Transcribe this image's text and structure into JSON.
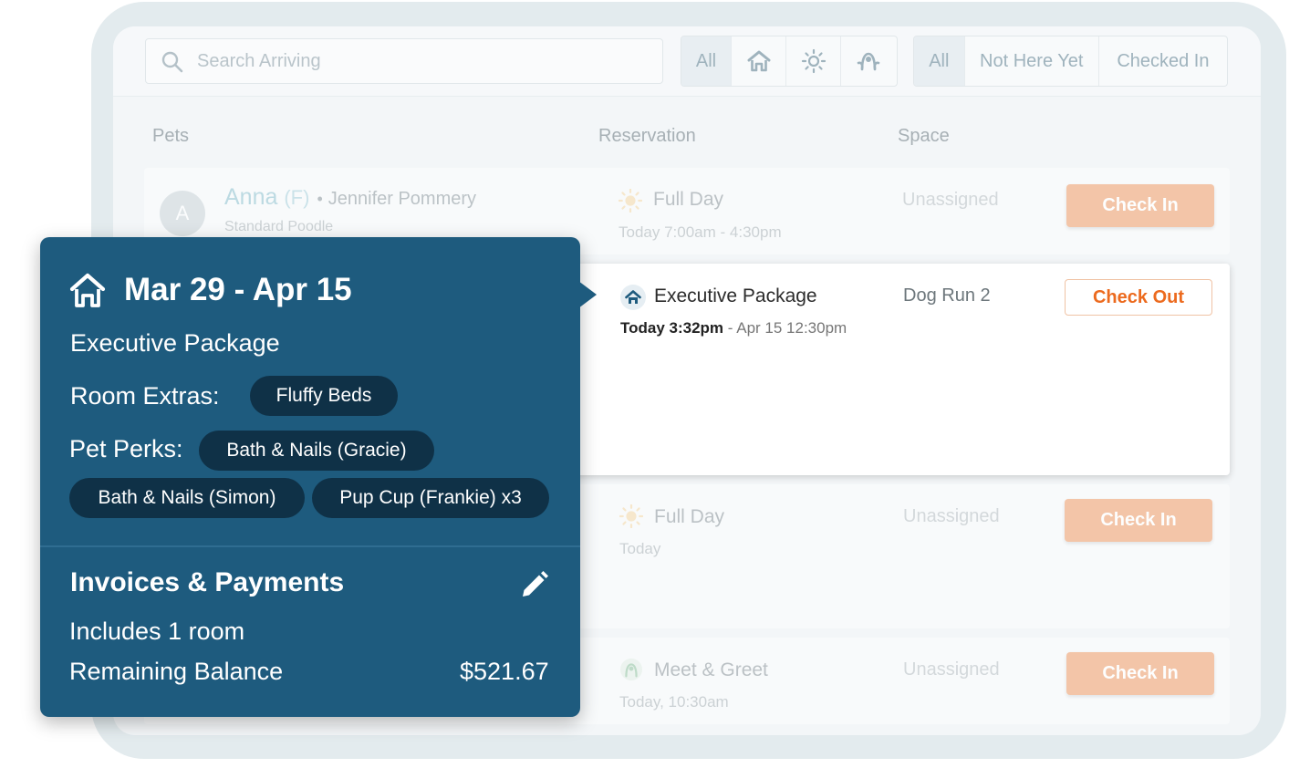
{
  "search": {
    "placeholder": "Search Arriving"
  },
  "type_filter": {
    "all": "All",
    "icons": [
      "house-icon",
      "sun-icon",
      "meet-greet-icon"
    ]
  },
  "status_filter": {
    "all": "All",
    "not_here_yet": "Not Here Yet",
    "checked_in": "Checked In"
  },
  "columns": {
    "pets": "Pets",
    "reservation": "Reservation",
    "space": "Space"
  },
  "rows": [
    {
      "avatar": "A",
      "pet": "Anna",
      "sex": "(F)",
      "owner": "Jennifer Pommery",
      "breed": "Standard Poodle",
      "reservation": "Full Day",
      "time": "Today 7:00am - 4:30pm",
      "space": "Unassigned",
      "action": "Check In"
    },
    {
      "reservation": "Executive Package",
      "time_bold": "Today 3:32pm",
      "time_sep": " - ",
      "time_rest": "Apr 15 12:30pm",
      "space": "Dog Run 2",
      "action": "Check Out"
    },
    {
      "reservation": "Full Day",
      "time": "Today",
      "space": "Unassigned",
      "action": "Check In"
    },
    {
      "reservation": "Meet & Greet",
      "time": "Today, 10:30am",
      "space": "Unassigned",
      "action": "Check In"
    }
  ],
  "popover": {
    "dates": "Mar 29 - Apr 15",
    "package": "Executive Package",
    "room_extras_label": "Room Extras:",
    "room_extras": [
      "Fluffy Beds"
    ],
    "pet_perks_label": "Pet Perks:",
    "pet_perks": [
      "Bath & Nails (Gracie)",
      "Bath & Nails (Simon)",
      "Pup Cup (Frankie) x3"
    ],
    "invoices_title": "Invoices & Payments",
    "includes": "Includes 1 room",
    "balance_label": "Remaining Balance",
    "balance_value": "$521.67"
  },
  "colors": {
    "popover_bg": "#1e5b7e",
    "pill_bg": "#0f3147",
    "accent_orange": "#ec6a1e",
    "check_in_bg": "#f2b994"
  }
}
